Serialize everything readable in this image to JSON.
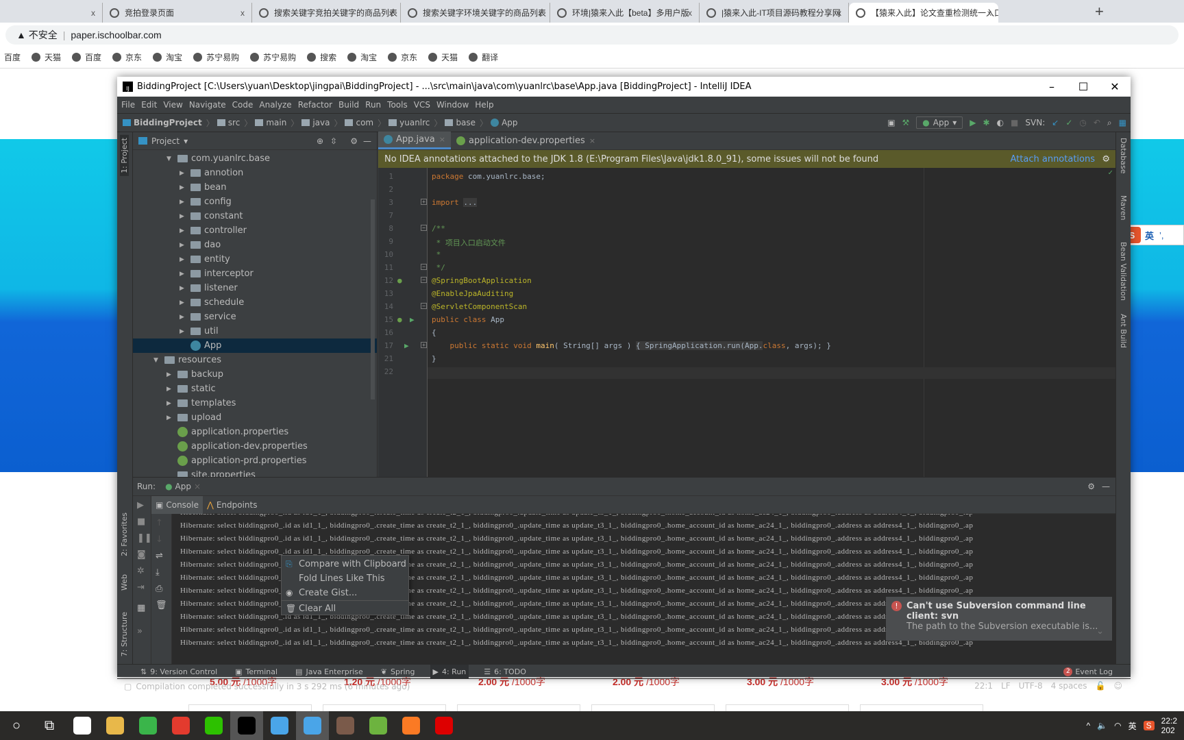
{
  "browser": {
    "tabs": [
      {
        "label": "",
        "active": false
      },
      {
        "label": "竞拍登录页面"
      },
      {
        "label": "搜索关键字竞拍关键字的商品列表"
      },
      {
        "label": "搜索关键字环境关键字的商品列表"
      },
      {
        "label": "环境|猿来入此【beta】多用户版"
      },
      {
        "label": "|猿来入此-IT项目源码教程分享网"
      },
      {
        "label": "【猿来入此】论文查重检测统一入口",
        "active": true
      }
    ],
    "close": "x",
    "new_tab": "+",
    "security": "不安全",
    "url": "paper.ischoolbar.com",
    "bookmarks": [
      "百度",
      "天猫",
      "百度",
      "京东",
      "淘宝",
      "苏宁易购",
      "苏宁易购",
      "搜索",
      "淘宝",
      "京东",
      "天猫",
      "翻译"
    ]
  },
  "ide": {
    "title": "BiddingProject [C:\\Users\\yuan\\Desktop\\jingpai\\BiddingProject] - ...\\src\\main\\java\\com\\yuanlrc\\base\\App.java [BiddingProject] - IntelliJ IDEA",
    "menu": [
      "File",
      "Edit",
      "View",
      "Navigate",
      "Code",
      "Analyze",
      "Refactor",
      "Build",
      "Run",
      "Tools",
      "VCS",
      "Window",
      "Help"
    ],
    "breadcrumbs": [
      "BiddingProject",
      "src",
      "main",
      "java",
      "com",
      "yuanlrc",
      "base",
      "App"
    ],
    "run_config": "App",
    "svn_label": "SVN:",
    "left_stripe": [
      "1: Project",
      "2: Favorites",
      "Web",
      "7: Structure"
    ],
    "right_stripe": [
      "Database",
      "Maven",
      "Bean Validation",
      "Ant Build"
    ],
    "project": {
      "header": "Project",
      "items": [
        {
          "label": "com.yuanlrc.base",
          "depth": 3,
          "type": "folder",
          "arrow": "open"
        },
        {
          "label": "annotion",
          "depth": 4,
          "type": "folder",
          "arrow": "closed"
        },
        {
          "label": "bean",
          "depth": 4,
          "type": "folder",
          "arrow": "closed"
        },
        {
          "label": "config",
          "depth": 4,
          "type": "folder",
          "arrow": "closed"
        },
        {
          "label": "constant",
          "depth": 4,
          "type": "folder",
          "arrow": "closed"
        },
        {
          "label": "controller",
          "depth": 4,
          "type": "folder",
          "arrow": "closed"
        },
        {
          "label": "dao",
          "depth": 4,
          "type": "folder",
          "arrow": "closed"
        },
        {
          "label": "entity",
          "depth": 4,
          "type": "folder",
          "arrow": "closed"
        },
        {
          "label": "interceptor",
          "depth": 4,
          "type": "folder",
          "arrow": "closed"
        },
        {
          "label": "listener",
          "depth": 4,
          "type": "folder",
          "arrow": "closed"
        },
        {
          "label": "schedule",
          "depth": 4,
          "type": "folder",
          "arrow": "closed"
        },
        {
          "label": "service",
          "depth": 4,
          "type": "folder",
          "arrow": "closed"
        },
        {
          "label": "util",
          "depth": 4,
          "type": "folder",
          "arrow": "closed"
        },
        {
          "label": "App",
          "depth": 4,
          "type": "app",
          "arrow": "",
          "selected": true
        },
        {
          "label": "resources",
          "depth": 2,
          "type": "folder",
          "arrow": "open"
        },
        {
          "label": "backup",
          "depth": 3,
          "type": "folder",
          "arrow": "closed"
        },
        {
          "label": "static",
          "depth": 3,
          "type": "folder",
          "arrow": "closed"
        },
        {
          "label": "templates",
          "depth": 3,
          "type": "folder",
          "arrow": "closed"
        },
        {
          "label": "upload",
          "depth": 3,
          "type": "folder",
          "arrow": "closed"
        },
        {
          "label": "application.properties",
          "depth": 3,
          "type": "spring",
          "arrow": ""
        },
        {
          "label": "application-dev.properties",
          "depth": 3,
          "type": "spring",
          "arrow": ""
        },
        {
          "label": "application-prd.properties",
          "depth": 3,
          "type": "spring",
          "arrow": ""
        },
        {
          "label": "site.properties",
          "depth": 3,
          "type": "file",
          "arrow": ""
        }
      ]
    },
    "editor_tabs": [
      {
        "label": "App.java",
        "active": true
      },
      {
        "label": "application-dev.properties"
      }
    ],
    "annotation_bar": {
      "message": "No IDEA annotations attached to the JDK 1.8 (E:\\Program Files\\Java\\jdk1.8.0_91), some issues will not be found",
      "link": "Attach annotations"
    },
    "code": [
      {
        "n": "1",
        "t": [
          [
            "package",
            "kw"
          ],
          [
            " com.yuanlrc.base;",
            ""
          ]
        ]
      },
      {
        "n": "2",
        "t": []
      },
      {
        "n": "3",
        "t": [
          [
            "import",
            "kw"
          ],
          [
            " ",
            ""
          ],
          [
            "...",
            "fd"
          ]
        ]
      },
      {
        "n": "7",
        "t": []
      },
      {
        "n": "8",
        "t": [
          [
            "/**",
            "cm"
          ]
        ]
      },
      {
        "n": "9",
        "t": [
          [
            " * ",
            "cm"
          ],
          [
            "项目入口启动文件",
            "dc"
          ]
        ]
      },
      {
        "n": "10",
        "t": [
          [
            " *",
            "cm"
          ]
        ]
      },
      {
        "n": "11",
        "t": [
          [
            " */",
            "cm"
          ]
        ]
      },
      {
        "n": "12",
        "t": [
          [
            "@SpringBootApplication",
            "an"
          ]
        ]
      },
      {
        "n": "13",
        "t": [
          [
            "@EnableJpaAuditing",
            "an"
          ]
        ]
      },
      {
        "n": "14",
        "t": [
          [
            "@ServletComponentScan",
            "an"
          ]
        ]
      },
      {
        "n": "15",
        "t": [
          [
            "public class ",
            "kw"
          ],
          [
            "App",
            ""
          ]
        ]
      },
      {
        "n": "16",
        "t": [
          [
            "{",
            ""
          ]
        ]
      },
      {
        "n": "17",
        "t": [
          [
            "    public static void ",
            "kw"
          ],
          [
            "main",
            "fn"
          ],
          [
            "( String[] args ) ",
            ""
          ],
          [
            "{ SpringApplication.run(App.",
            "fd"
          ],
          [
            "class",
            "kw"
          ],
          [
            ", args); }",
            ""
          ]
        ]
      },
      {
        "n": "21",
        "t": [
          [
            "}",
            ""
          ]
        ]
      },
      {
        "n": "22",
        "t": []
      }
    ],
    "run": {
      "label": "Run:",
      "config": "App",
      "tabs": [
        "Console",
        "Endpoints"
      ],
      "lines": [
        "Hibernate: select biddingpro0_.id as id1_1_, biddingpro0_.create_time as create_t2_1_, biddingpro0_.update_time as update_t3_1_, biddingpro0_.home_account_id as home_ac24_1_, biddingpro0_.address as address4_1_, biddingpro0_.ap",
        "Hibernate: select biddingpro0_.id as id1_1_, biddingpro0_.create_time as create_t2_1_, biddingpro0_.update_time as update_t3_1_, biddingpro0_.home_account_id as home_ac24_1_, biddingpro0_.address as address4_1_, biddingpro0_.ap",
        "Hibernate: select biddingpro0_.id as id1_1_, biddingpro0_.create_time as create_t2_1_, biddingpro0_.update_time as update_t3_1_, biddingpro0_.home_account_id as home_ac24_1_, biddingpro0_.address as address4_1_, biddingpro0_.ap",
        "Hibernate: select biddingpro0_.id as id1_1_, biddingpro0_.create_time as create_t2_1_, biddingpro0_.update_time as update_t3_1_, biddingpro0_.home_account_id as home_ac24_1_, biddingpro0_.address as address4_1_, biddingpro0_.ap",
        "Hibernate: select biddingpro0_.id as id1_1_, biddingpro0_.create_time as create_t2_1_, biddingpro0_.update_time as update_t3_1_, biddingpro0_.home_account_id as home_ac24_1_, biddingpro0_.address as address4_1_, biddingpro0_.ap",
        "Hibernate: select biddingpro0_.id as id1_1_, biddingpro0_.create_time as create_t2_1_, biddingpro0_.update_time as update_t3_1_, biddingpro0_.home_account_id as home_ac24_1_, biddingpro0_.address as address4_1_, biddingpro0_.ap",
        "Hibernate: select biddingpro0_.id as id1_1_, biddingpro0_.create_time as create_t2_1_, biddingpro0_.update_time as update_t3_1_, biddingpro0_.home_account_id as home_ac24_1_, biddingpro0_.address as address4_1_, biddingpro0_.ap",
        "Hibernate: select biddingpro0_.id as id1_1_, biddingpro0_.create_time as create_t2_1_, biddingpro0_.update_time as update_t3_1_, biddingpro0_.home_account_id as home_ac24_1_, biddingpro0_.address as address4_1_, biddingpro0_.ap",
        "Hibernate: select biddingpro0_.id as id1_1_, biddingpro0_.create_time as create_t2_1_, biddingpro0_.update_time as update_t3_1_, biddingpro0_.home_account_id as home_ac24_1_, biddingpro0_.address as address4_1_, biddingpro0_.ap",
        "Hibernate: select biddingpro0_.id as id1_1_, biddingpro0_.create_time as create_t2_1_, biddingpro0_.update_time as update_t3_1_, biddingpro0_.home_account_id as home_ac24_1_, biddingpro0_.address as address4_1_, biddingpro0_.ap",
        "Hibernate: select biddingpro0_.id as id1_1_, biddingpro0_.create_time as create_t2_1_, biddingpro0_.update_time as update_t3_1_, biddingpro0_.home_account_id as home_ac24_1_, biddingpro0_.address as address4_1_, biddingpro0_.ap"
      ]
    },
    "context_menu": [
      "Compare with Clipboard",
      "Fold Lines Like This",
      "Create Gist...",
      "Clear All"
    ],
    "notification": {
      "title": "Can't use Subversion command line client: svn",
      "body": "The path to the Subversion executable is..."
    },
    "bottom_tools": [
      "9: Version Control",
      "Terminal",
      "Java Enterprise",
      "Spring",
      "4: Run",
      "6: TODO"
    ],
    "event_log": {
      "label": "Event Log",
      "count": "2"
    },
    "status": {
      "message": "Compilation completed successfully in 3 s 292 ms (6 minutes ago)",
      "position": "22:1",
      "line_sep": "LF",
      "encoding": "UTF-8",
      "indent": "4 spaces"
    }
  },
  "page": {
    "prices": [
      {
        "v": "5.00 元",
        "u": " /1000字"
      },
      {
        "v": "1.20 元",
        "u": " /1000字"
      },
      {
        "v": "2.00 元",
        "u": " /1000字"
      },
      {
        "v": "2.00 元",
        "u": " /1000字"
      },
      {
        "v": "3.00 元",
        "u": " /1000字"
      },
      {
        "v": "3.00 元",
        "u": " /1000字"
      }
    ]
  },
  "ime": "英",
  "taskbar": {
    "clock_time": "22:2",
    "clock_date": "202"
  },
  "colors": {
    "accent": "#4a88c7",
    "ide_bg": "#3c3f41",
    "editor_bg": "#2b2b2b",
    "selection": "#0d293e",
    "price": "#c9302c"
  }
}
